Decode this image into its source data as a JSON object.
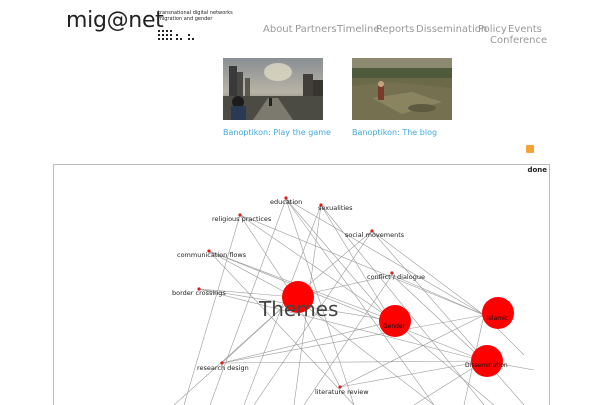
{
  "header": {
    "logo_text": "mig@net",
    "logo_subtitle": [
      "transnational digital networks",
      "migration and gender"
    ]
  },
  "nav": {
    "about": "About",
    "partners": "Partners",
    "timeline": "Timeline",
    "reports": "Reports",
    "dissemination": "Dissemination",
    "policy": "Policy",
    "events": "Events",
    "conference": "Conference"
  },
  "features": [
    {
      "caption": "Banoptikon: Play the game"
    },
    {
      "caption": "Banoptikon: The blog"
    }
  ],
  "rss": {
    "icon": "rss-icon",
    "color": "#f7a233"
  },
  "graph": {
    "status": "done",
    "central_label": "Themes",
    "hub_color": "#ff0000",
    "topics": {
      "education": "education",
      "sexualities": "sexualities",
      "religious_practices": "religious practices",
      "social_movements": "social movements",
      "communication_flows": "communication flows",
      "conflict_dialogue": "conflict / dialogue",
      "border_crossings": "border crossings",
      "research_design": "research design",
      "literature_review": "literature review"
    },
    "hubs": {
      "gender": "Gender",
      "islamic": "Islamic",
      "dissemination": "Dissemination"
    }
  }
}
